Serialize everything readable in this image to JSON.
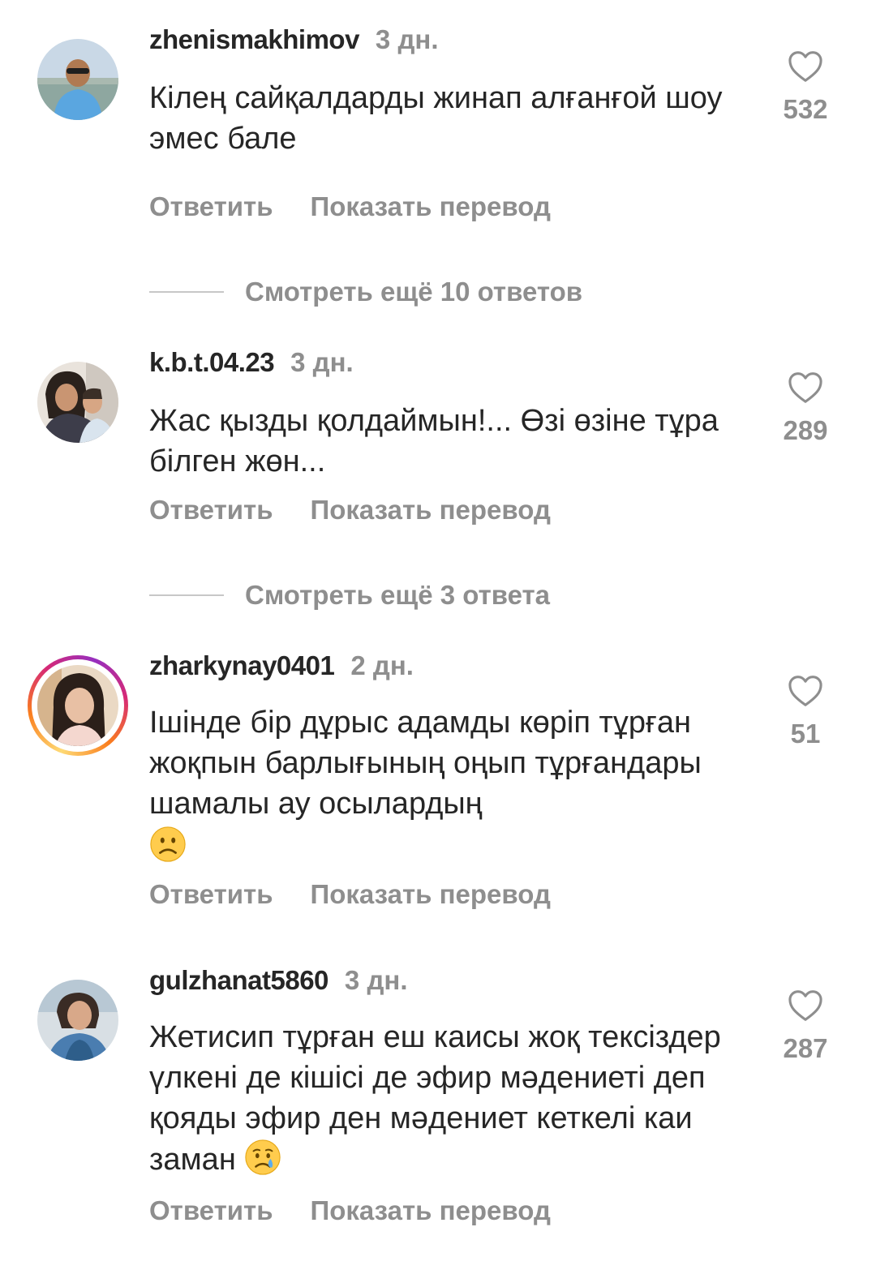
{
  "comments": [
    {
      "username": "zhenismakhimov",
      "time": "3 дн.",
      "text": "Кілең сайқалдарды жинап алғанғой шоу эмес бале",
      "likes": "532",
      "reply_label": "Ответить",
      "translate_label": "Показать перевод",
      "story_ring": false
    },
    {
      "username": "k.b.t.04.23",
      "time": "3 дн.",
      "text": "Жас қызды қолдаймын!... Өзі өзіне тұра білген жөн...",
      "likes": "289",
      "reply_label": "Ответить",
      "translate_label": "Показать перевод",
      "story_ring": false
    },
    {
      "username": "zharkynay0401",
      "time": "2 дн.",
      "text": "Ішінде бір дұрыс адамды көріп тұрған жоқпын барлығының оңып тұрғандары шамалы ау осылардың",
      "emoji": "frowning-face",
      "likes": "51",
      "reply_label": "Ответить",
      "translate_label": "Показать перевод",
      "story_ring": true
    },
    {
      "username": "gulzhanat5860",
      "time": "3 дн.",
      "text": "Жетисип тұрған еш каисы жоқ тексіздер үлкені де кішісі де эфир мәдениеті деп қояды эфир ден мәдениет кеткелі каи заман",
      "emoji": "crying-face",
      "likes": "287",
      "reply_label": "Ответить",
      "translate_label": "Показать перевод",
      "story_ring": false
    }
  ],
  "replies": [
    {
      "label": "Смотреть ещё 10 ответов"
    },
    {
      "label": "Смотреть ещё 3 ответа"
    }
  ],
  "icons": {
    "like": "heart-outline-icon"
  },
  "colors": {
    "text_primary": "#262626",
    "text_secondary": "#8e8e8e",
    "divider": "#c7c7c7"
  }
}
